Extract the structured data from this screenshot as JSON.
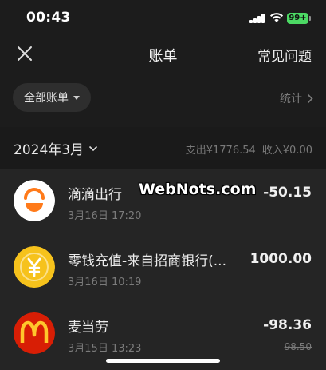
{
  "status_bar": {
    "time": "00:43",
    "battery": "99+"
  },
  "nav": {
    "title": "账单",
    "right_link": "常见问题",
    "close_icon": "close-icon"
  },
  "filter": {
    "selected": "全部账单",
    "stats_label": "统计"
  },
  "month": {
    "label": "2024年3月",
    "expense_label": "支出",
    "expense_value": "¥1776.54",
    "income_label": "收入",
    "income_value": "¥0.00"
  },
  "transactions": [
    {
      "name": "滴滴出行",
      "date": "3月16日 17:20",
      "amount": "-50.15",
      "icon": "didi-logo",
      "color": "#ff7a1a"
    },
    {
      "name": "零钱充值-来自招商银行(...",
      "date": "3月16日 10:19",
      "amount": "1000.00",
      "icon": "yuan-coin-icon",
      "color": "#f6c21c"
    },
    {
      "name": "麦当劳",
      "date": "3月15日 13:23",
      "amount": "-98.36",
      "original_amount": "98.50",
      "icon": "mcdonalds-logo",
      "color": "#d81e05"
    }
  ],
  "watermark": "WebNots.com",
  "colors": {
    "background": "#1c1c1c",
    "list_background": "#252525",
    "battery": "#4cd964"
  }
}
